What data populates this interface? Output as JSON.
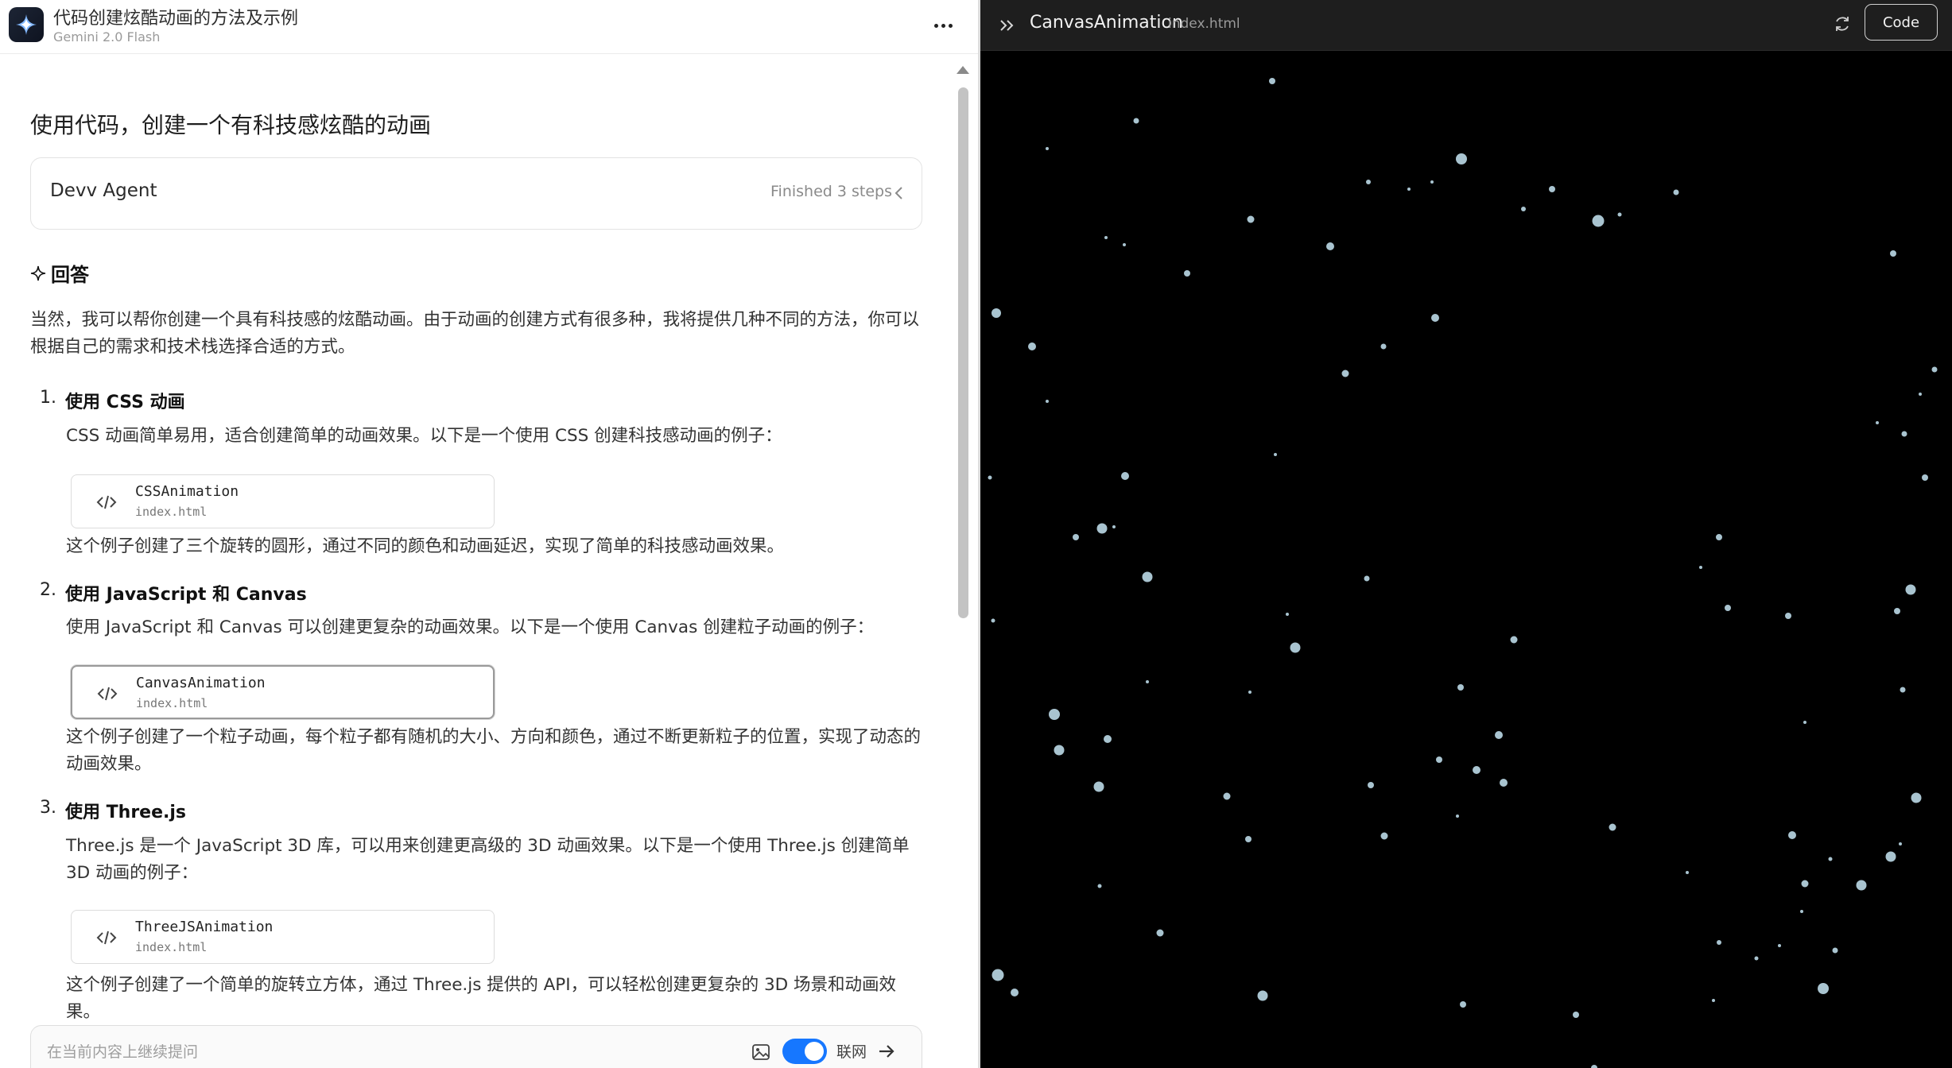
{
  "chat": {
    "title": "代码创建炫酷动画的方法及示例",
    "model": "Gemini 2.0 Flash",
    "user_question": "使用代码，创建一个有科技感炫酷的动画",
    "agent": {
      "name": "Devv Agent",
      "status": "Finished 3 steps"
    },
    "answer_heading": "回答",
    "intro": "当然，我可以帮你创建一个具有科技感的炫酷动画。由于动画的创建方式有很多种，我将提供几种不同的方法，你可以根据自己的需求和技术栈选择合适的方式。",
    "sections": [
      {
        "num": "1.",
        "title": "使用 CSS 动画",
        "lead": "CSS 动画简单易用，适合创建简单的动画效果。以下是一个使用 CSS 创建科技感动画的例子：",
        "card": {
          "name": "CSSAnimation",
          "file": "index.html"
        },
        "after": "这个例子创建了三个旋转的圆形，通过不同的颜色和动画延迟，实现了简单的科技感动画效果。"
      },
      {
        "num": "2.",
        "title": "使用 JavaScript 和 Canvas",
        "lead": "使用 JavaScript 和 Canvas 可以创建更复杂的动画效果。以下是一个使用 Canvas 创建粒子动画的例子：",
        "card": {
          "name": "CanvasAnimation",
          "file": "index.html"
        },
        "after": "这个例子创建了一个粒子动画，每个粒子都有随机的大小、方向和颜色，通过不断更新粒子的位置，实现了动态的动画效果。"
      },
      {
        "num": "3.",
        "title": "使用 Three.js",
        "lead": "Three.js 是一个 JavaScript 3D 库，可以用来创建更高级的 3D 动画效果。以下是一个使用 Three.js 创建简单 3D 动画的例子：",
        "card": {
          "name": "ThreeJSAnimation",
          "file": "index.html"
        },
        "after": "这个例子创建了一个简单的旋转立方体，通过 Three.js 提供的 API，可以轻松创建更复杂的 3D 场景和动画效果。"
      }
    ],
    "input": {
      "placeholder": "在当前内容上继续提问",
      "web_toggle_label": "联网",
      "web_toggle_on": true
    }
  },
  "preview": {
    "title": "CanvasAnimation",
    "file": "index.html",
    "code_button": "Code",
    "background_color": "#000000",
    "particle_color": "#a9c4d0"
  },
  "icons": {
    "app_logo": "sparkle-logo-icon",
    "more": "more-dots-icon",
    "agent_chevron": "chevron-left-icon",
    "answer": "sparkle-outline-icon",
    "code": "code-brackets-icon",
    "image_upload": "image-icon",
    "send": "arrow-right-icon",
    "collapse": "double-chevron-right-icon",
    "refresh": "refresh-icon"
  }
}
